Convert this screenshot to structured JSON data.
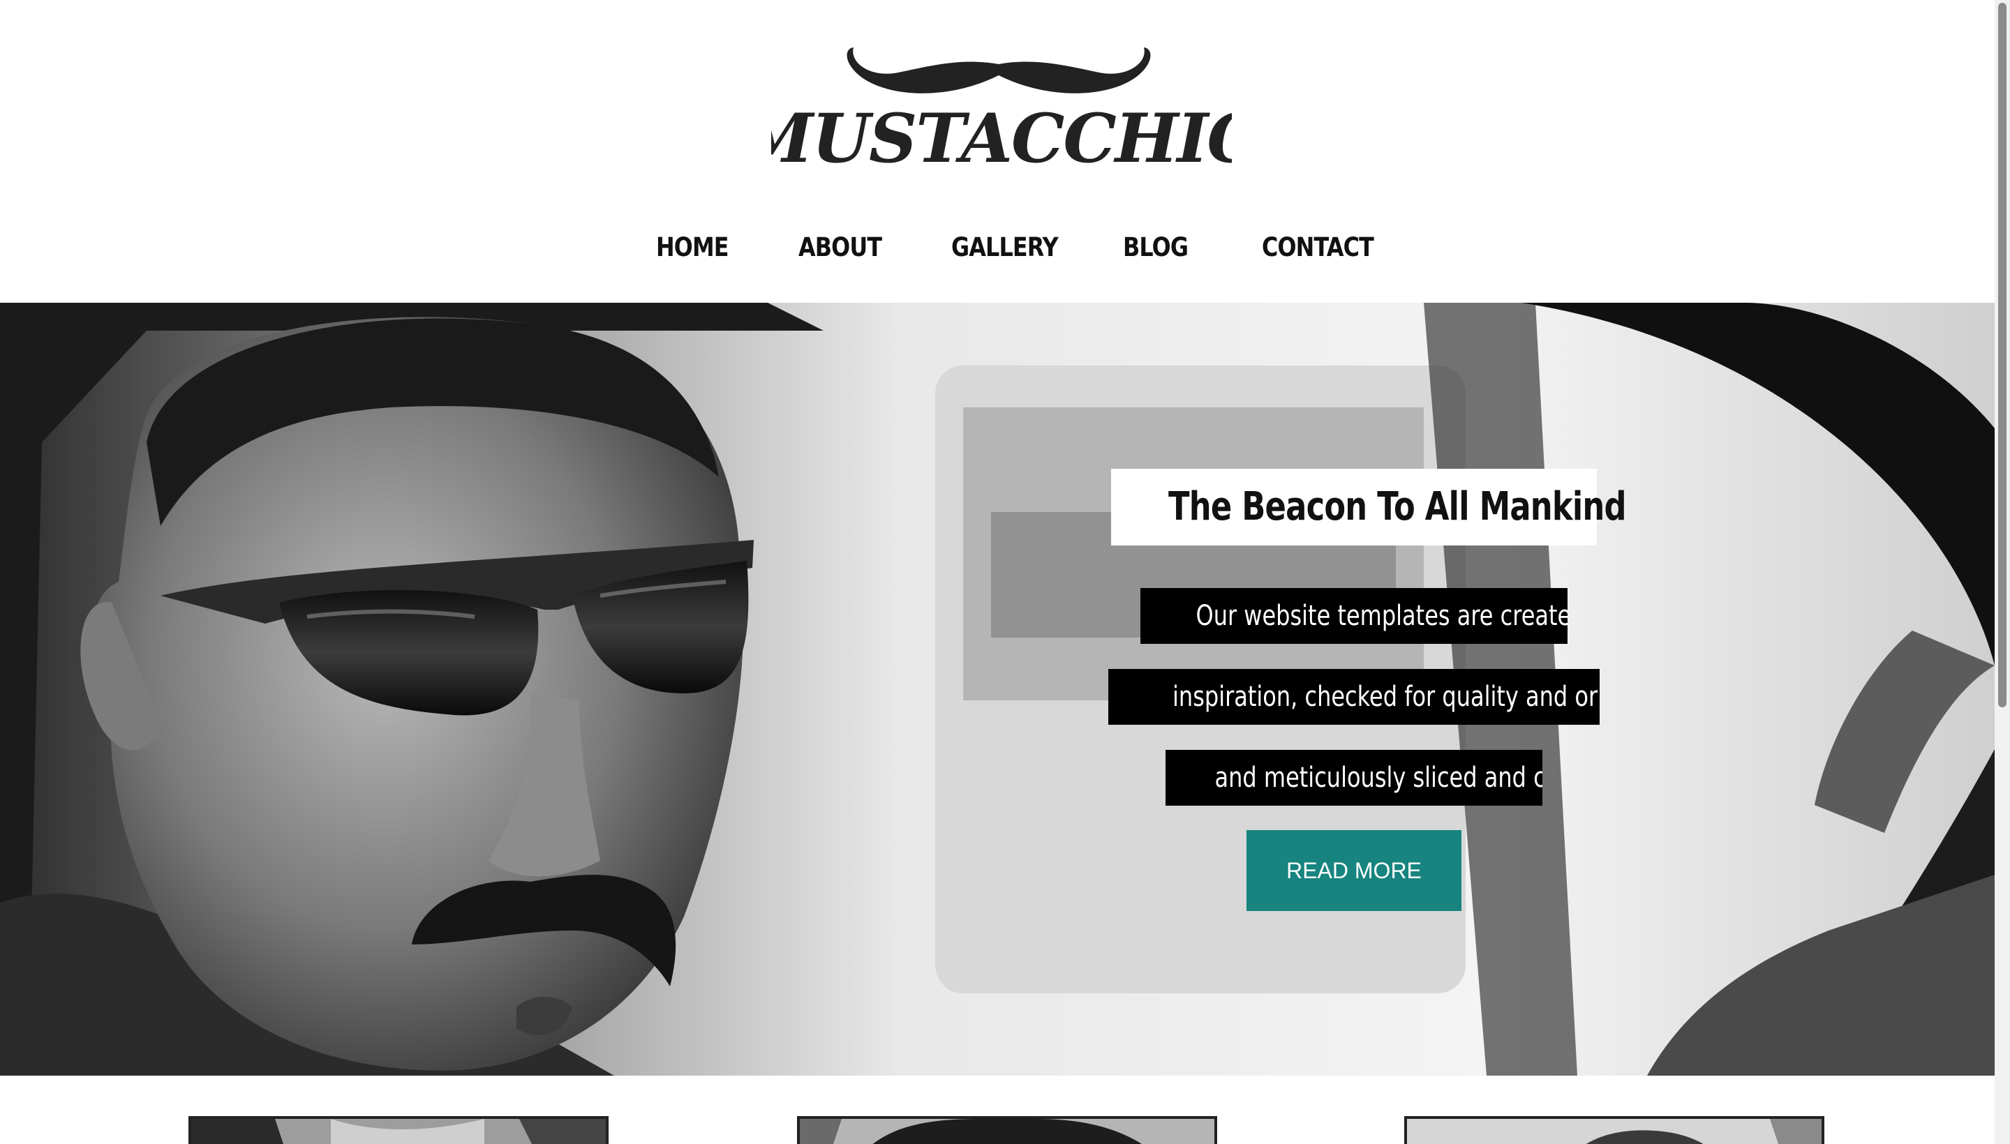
{
  "brand": {
    "logo_text": "MUSTACCHIO"
  },
  "nav": {
    "items": [
      {
        "label": "HOME"
      },
      {
        "label": "ABOUT"
      },
      {
        "label": "GALLERY"
      },
      {
        "label": "BLOG"
      },
      {
        "label": "CONTACT"
      }
    ]
  },
  "hero": {
    "title": "The Beacon To All Mankind",
    "lines": [
      "Our website templates are created with",
      "inspiration, checked for quality and originality",
      "and meticulously sliced and coded."
    ],
    "button_label": "READ MORE",
    "colors": {
      "button": "#17847f",
      "text_box": "#000000",
      "title_box": "#ffffff"
    }
  },
  "cards": [
    {
      "image": "portrait-photo"
    },
    {
      "image": "hat-photo"
    },
    {
      "image": "portrait-photo"
    }
  ]
}
